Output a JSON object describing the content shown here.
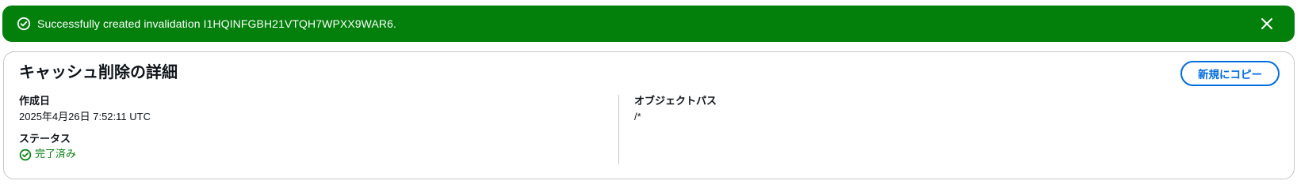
{
  "flash": {
    "message": "Successfully created invalidation I1HQINFGBH21VTQH7WPXX9WAR6.",
    "status_icon": "check-circle-icon",
    "dismiss_icon": "close-icon",
    "color": "#037f0c"
  },
  "panel": {
    "title": "キャッシュ削除の詳細",
    "copy_button_label": "新規にコピー",
    "accent_color": "#006ce0"
  },
  "details": {
    "created_label": "作成日",
    "created_value": "2025年4月26日 7:52:11 UTC",
    "status_label": "ステータス",
    "status_value": "完了済み",
    "status_icon": "check-circle-icon",
    "object_path_label": "オブジェクトパス",
    "object_path_value": "/*"
  }
}
